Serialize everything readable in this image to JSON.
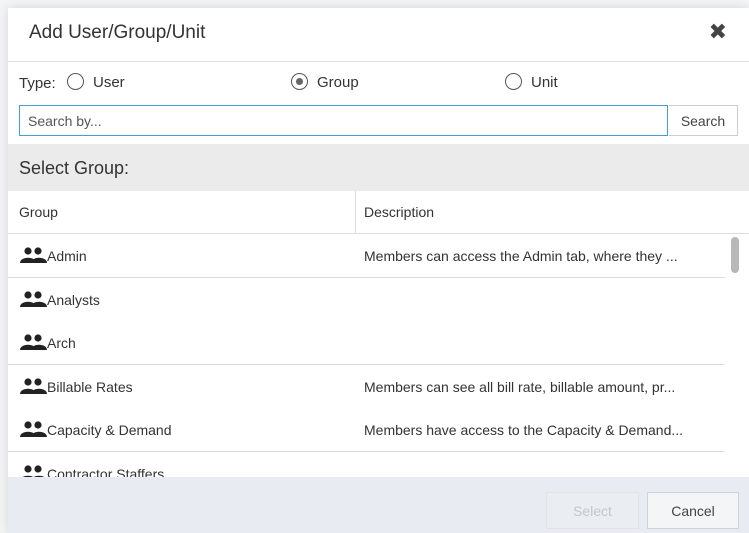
{
  "dialog": {
    "title": "Add User/Group/Unit",
    "close_glyph": "✖"
  },
  "type_selector": {
    "label": "Type:",
    "options": [
      {
        "label": "User",
        "checked": false
      },
      {
        "label": "Group",
        "checked": true
      },
      {
        "label": "Unit",
        "checked": false
      }
    ]
  },
  "search": {
    "placeholder": "Search by...",
    "value": "",
    "button_label": "Search"
  },
  "section": {
    "title": "Select Group:"
  },
  "table": {
    "columns": [
      "Group",
      "Description"
    ],
    "rows": [
      {
        "name": "Admin",
        "description": "Members can access the Admin tab, where they ..."
      },
      {
        "name": "Analysts",
        "description": ""
      },
      {
        "name": "Arch",
        "description": ""
      },
      {
        "name": "Billable Rates",
        "description": "Members can see all bill rate, billable amount, pr..."
      },
      {
        "name": "Capacity & Demand",
        "description": "Members have access to the Capacity & Demand..."
      },
      {
        "name": "Contractor Staffers",
        "description": ""
      }
    ],
    "row_icon": "group-icon"
  },
  "footer": {
    "select_label": "Select",
    "select_enabled": false,
    "cancel_label": "Cancel"
  },
  "colors": {
    "accent_border": "#4a9ad6",
    "section_bg": "#ebebeb",
    "footer_bg": "#e8ebf1"
  }
}
